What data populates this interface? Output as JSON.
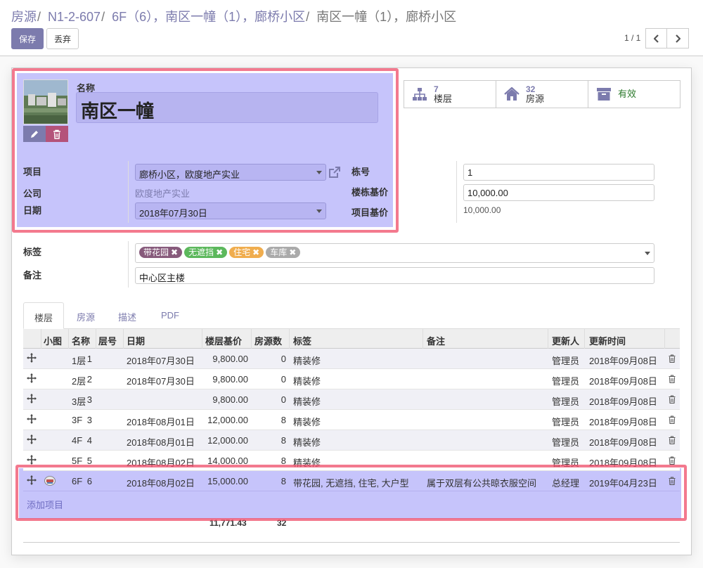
{
  "breadcrumb": {
    "items": [
      "房源",
      "N1-2-607",
      "6F（6），南区一幢（1），廊桥小区"
    ],
    "separator": "/",
    "current": "南区一幢（1），廊桥小区"
  },
  "toolbar": {
    "save_label": "保存",
    "discard_label": "丢弃"
  },
  "pager": {
    "value": "1 / 1"
  },
  "record": {
    "name_label": "名称",
    "name": "南区一幢",
    "project_label": "项目",
    "project": "廊桥小区，欧度地产实业",
    "company_label": "公司",
    "company": "欧度地产实业",
    "date_label": "日期",
    "date": "2018年07月30日",
    "building_no_label": "栋号",
    "building_no": "1",
    "base_price_label": "楼栋基价",
    "base_price": "10,000.00",
    "project_price_label": "项目基价",
    "project_price": "10,000.00",
    "tags_label": "标签",
    "tags": [
      {
        "name": "带花园",
        "color": "#875a7b"
      },
      {
        "name": "无遮挡",
        "color": "#5cb85c"
      },
      {
        "name": "住宅",
        "color": "#f0ad4e"
      },
      {
        "name": "车库",
        "color": "#aaaaaa"
      }
    ],
    "note_label": "备注",
    "note": "中心区主楼"
  },
  "smart_buttons": [
    {
      "number": "7",
      "label": "楼层",
      "icon": "sitemap-icon"
    },
    {
      "number": "32",
      "label": "房源",
      "icon": "home-icon"
    },
    {
      "number": "",
      "label": "有效",
      "icon": "archive-icon"
    }
  ],
  "tabs": [
    "楼层",
    "房源",
    "描述",
    "PDF"
  ],
  "active_tab": "楼层",
  "table": {
    "columns": [
      "小图",
      "名称",
      "层号",
      "日期",
      "楼层基价",
      "房源数",
      "标签",
      "备注",
      "更新人",
      "更新时间"
    ],
    "rows": [
      {
        "name": "1层",
        "floor": "1",
        "date": "2018年07月30日",
        "price": "9,800.00",
        "count": "0",
        "tags": "精装修",
        "note": "",
        "updater": "管理员",
        "updated": "2018年09月08日"
      },
      {
        "name": "2层",
        "floor": "2",
        "date": "2018年07月30日",
        "price": "9,800.00",
        "count": "0",
        "tags": "精装修",
        "note": "",
        "updater": "管理员",
        "updated": "2018年09月08日"
      },
      {
        "name": "3层",
        "floor": "3",
        "date": "",
        "price": "9,800.00",
        "count": "0",
        "tags": "精装修",
        "note": "",
        "updater": "管理员",
        "updated": "2018年09月08日"
      },
      {
        "name": "3F",
        "floor": "3",
        "date": "2018年08月01日",
        "price": "12,000.00",
        "count": "8",
        "tags": "精装修",
        "note": "",
        "updater": "管理员",
        "updated": "2018年09月08日"
      },
      {
        "name": "4F",
        "floor": "4",
        "date": "2018年08月01日",
        "price": "12,000.00",
        "count": "8",
        "tags": "精装修",
        "note": "",
        "updater": "管理员",
        "updated": "2018年09月08日"
      },
      {
        "name": "5F",
        "floor": "5",
        "date": "2018年08月02日",
        "price": "14,000.00",
        "count": "8",
        "tags": "精装修",
        "note": "",
        "updater": "管理员",
        "updated": "2018年09月08日"
      },
      {
        "name": "6F",
        "floor": "6",
        "date": "2018年08月02日",
        "price": "15,000.00",
        "count": "8",
        "tags": "带花园, 无遮挡, 住宅, 大户型",
        "note": "属于双层有公共晾衣服空间",
        "updater": "总经理",
        "updated": "2019年04月23日"
      }
    ],
    "add_line_label": "添加项目",
    "total_price": "11,771.43",
    "total_count": "32"
  }
}
